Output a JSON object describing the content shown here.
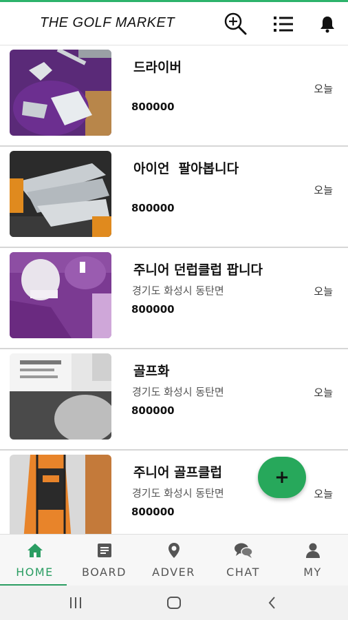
{
  "app": {
    "title": "THE GOLF MARKET",
    "accent_color": "#2a9d62",
    "top_icons": [
      "search-plus-icon",
      "list-icon",
      "bell-icon"
    ]
  },
  "listings": [
    {
      "title": "드라이버",
      "location": "",
      "price": "800000",
      "date": "오늘"
    },
    {
      "title": "아이언  팔아봅니다",
      "location": "",
      "price": "800000",
      "date": "오늘"
    },
    {
      "title": "주니어 던럽클럽 팝니다",
      "location": "경기도 화성시 동탄면",
      "price": "800000",
      "date": "오늘"
    },
    {
      "title": "골프화",
      "location": "경기도 화성시 동탄면",
      "price": "800000",
      "date": "오늘"
    },
    {
      "title": "주니어 골프클럽",
      "location": "경기도 화성시 동탄면",
      "price": "800000",
      "date": "오늘"
    }
  ],
  "fab": {
    "label": "+"
  },
  "bottom_nav": [
    {
      "label": "HOME",
      "icon": "home-icon",
      "active": true
    },
    {
      "label": "BOARD",
      "icon": "board-icon",
      "active": false
    },
    {
      "label": "ADVER",
      "icon": "location-pin-icon",
      "active": false
    },
    {
      "label": "CHAT",
      "icon": "chat-icon",
      "active": false
    },
    {
      "label": "MY",
      "icon": "user-icon",
      "active": false
    }
  ],
  "system_nav": [
    "recent-apps-icon",
    "home-circle-icon",
    "back-icon"
  ]
}
